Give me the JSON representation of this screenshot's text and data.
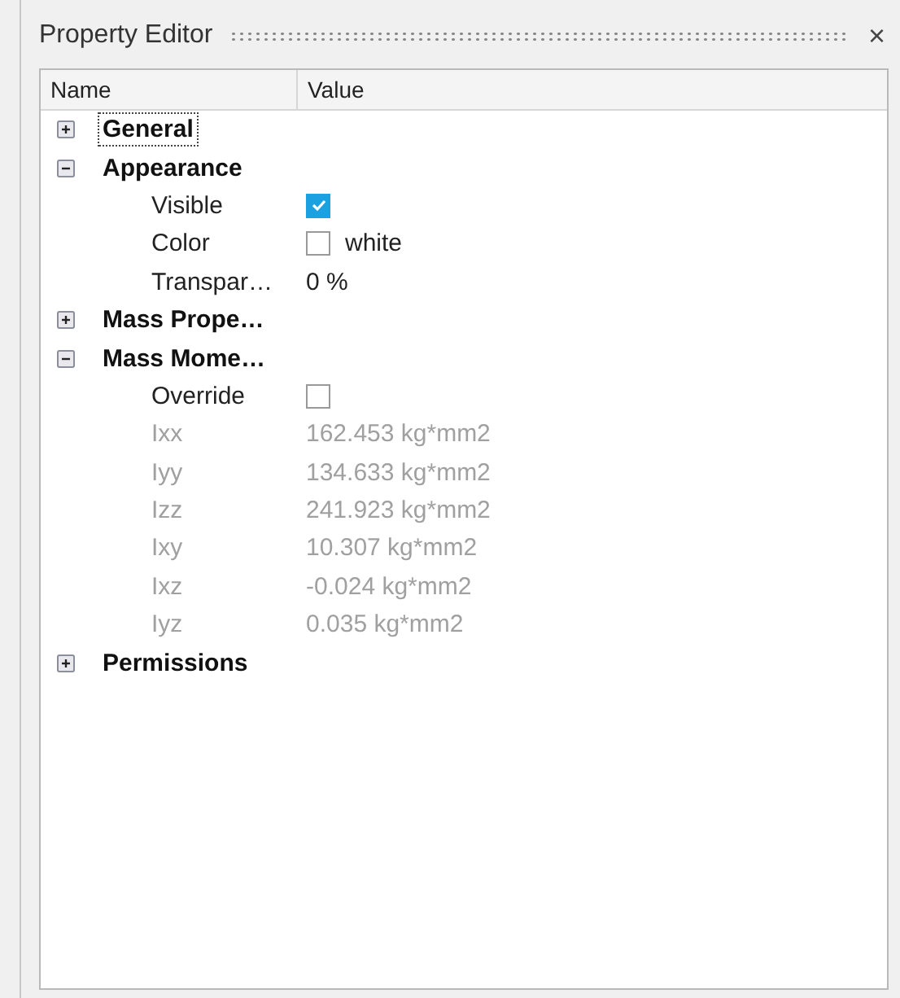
{
  "panel": {
    "title": "Property Editor",
    "close": "×"
  },
  "table": {
    "columns": [
      "Name",
      "Value"
    ],
    "groups": [
      {
        "name": "General",
        "expanded": false,
        "focused": true
      },
      {
        "name": "Appearance",
        "expanded": true,
        "focused": false,
        "children": [
          {
            "kind": "checkbox",
            "name": "Visible",
            "checked": true,
            "disabled": false
          },
          {
            "kind": "color",
            "name": "Color",
            "value": "white",
            "color": "#ffffff",
            "disabled": false
          },
          {
            "kind": "text",
            "name": "Transpar…",
            "value": "0 %",
            "disabled": false
          }
        ]
      },
      {
        "name": "Mass Prope…",
        "expanded": false,
        "focused": false
      },
      {
        "name": "Mass Mome…",
        "expanded": true,
        "focused": false,
        "children": [
          {
            "kind": "checkbox",
            "name": "Override",
            "checked": false,
            "disabled": false
          },
          {
            "kind": "text",
            "name": "Ixx",
            "value": "162.453 kg*mm2",
            "disabled": true
          },
          {
            "kind": "text",
            "name": "Iyy",
            "value": "134.633 kg*mm2",
            "disabled": true
          },
          {
            "kind": "text",
            "name": "Izz",
            "value": "241.923 kg*mm2",
            "disabled": true
          },
          {
            "kind": "text",
            "name": "Ixy",
            "value": "10.307 kg*mm2",
            "disabled": true
          },
          {
            "kind": "text",
            "name": "Ixz",
            "value": "-0.024 kg*mm2",
            "disabled": true
          },
          {
            "kind": "text",
            "name": "Iyz",
            "value": "0.035 kg*mm2",
            "disabled": true
          }
        ]
      },
      {
        "name": "Permissions",
        "expanded": false,
        "focused": false
      }
    ]
  }
}
